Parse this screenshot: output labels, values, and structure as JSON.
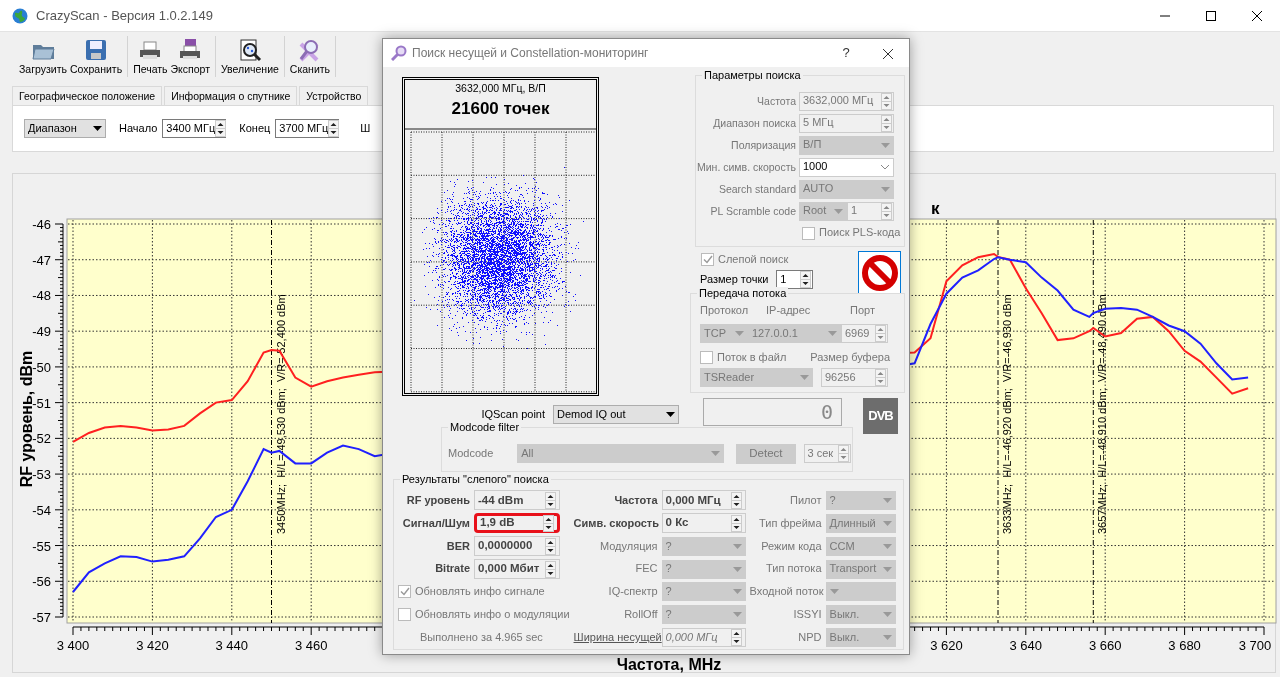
{
  "window": {
    "title": "CrazyScan - Версия 1.0.2.149"
  },
  "toolbar": {
    "groups": [
      {
        "buttons": [
          {
            "label": "Загрузить"
          },
          {
            "label": "Сохранить"
          }
        ]
      },
      {
        "buttons": [
          {
            "label": "Печать"
          },
          {
            "label": "Экспорт"
          }
        ]
      },
      {
        "buttons": [
          {
            "label": "Увеличение"
          }
        ]
      },
      {
        "buttons": [
          {
            "label": "Сканить"
          }
        ]
      }
    ]
  },
  "tabs": [
    {
      "label": "Географическое положение",
      "selected": false
    },
    {
      "label": "Информация о спутнике",
      "selected": false
    },
    {
      "label": "Устройство",
      "selected": false
    }
  ],
  "range_bar": {
    "mode": "Диапазон",
    "start_label": "Начало",
    "start": "3400 МГц",
    "end_label": "Конец",
    "end": "3700 МГц",
    "cut_label": "Ш"
  },
  "chart": {
    "chart_data": {
      "type": "line",
      "title": "к",
      "xlabel": "Частота, MHz",
      "ylabel": "RF уровень, dBm",
      "xlim": [
        3400,
        3700
      ],
      "ylim": [
        -57,
        -46
      ],
      "grid": true,
      "x": [
        3400,
        3404,
        3408,
        3412,
        3416,
        3420,
        3424,
        3428,
        3432,
        3436,
        3440,
        3444,
        3448,
        3450,
        3452,
        3456,
        3460,
        3464,
        3468,
        3472,
        3476,
        3612,
        3616,
        3620,
        3624,
        3628,
        3632,
        3633,
        3636,
        3640,
        3644,
        3648,
        3652,
        3656,
        3657,
        3660,
        3664,
        3668,
        3672,
        3676,
        3680,
        3684,
        3688,
        3692,
        3696
      ],
      "series": [
        {
          "color": "#ff2020",
          "values": [
            -52.1,
            -51.85,
            -51.7,
            -51.65,
            -51.7,
            -51.78,
            -51.75,
            -51.65,
            -51.3,
            -51.0,
            -50.93,
            -50.4,
            -49.6,
            -49.53,
            -49.55,
            -50.3,
            -50.55,
            -50.4,
            -50.3,
            -50.22,
            -50.15,
            -49.6,
            -49.2,
            -47.6,
            -47.16,
            -46.93,
            -46.84,
            -46.92,
            -47.0,
            -47.8,
            -48.5,
            -49.25,
            -49.2,
            -49.0,
            -48.91,
            -49.15,
            -49.05,
            -48.65,
            -48.6,
            -49.0,
            -49.55,
            -49.85,
            -50.3,
            -50.75,
            -50.6
          ]
        },
        {
          "color": "#2020ff",
          "values": [
            -56.3,
            -55.75,
            -55.5,
            -55.3,
            -55.32,
            -55.45,
            -55.4,
            -55.3,
            -54.8,
            -54.2,
            -54.0,
            -53.2,
            -52.3,
            -52.4,
            -52.35,
            -52.7,
            -52.7,
            -52.4,
            -52.2,
            -52.3,
            -52.5,
            -49.9,
            -48.8,
            -47.95,
            -47.5,
            -47.3,
            -46.98,
            -46.93,
            -47.0,
            -47.07,
            -47.5,
            -47.86,
            -48.4,
            -48.6,
            -48.49,
            -48.37,
            -48.35,
            -48.4,
            -48.6,
            -48.84,
            -49.0,
            -49.35,
            -49.9,
            -50.35,
            -50.3
          ]
        }
      ],
      "xticks": [
        {
          "value": 3400,
          "label": "3 400"
        },
        {
          "value": 3420,
          "label": "3 420"
        },
        {
          "value": 3440,
          "label": "3 440"
        },
        {
          "value": 3460,
          "label": "3 460"
        },
        {
          "value": 3620,
          "label": "3 620"
        },
        {
          "value": 3640,
          "label": "3 640"
        },
        {
          "value": 3660,
          "label": "3 660"
        },
        {
          "value": 3680,
          "label": "3 680"
        },
        {
          "value": 3700,
          "label": "3 700"
        }
      ],
      "yticks": [
        -46,
        -47,
        -48,
        -49,
        -50,
        -51,
        -52,
        -53,
        -54,
        -55,
        -56,
        -57
      ],
      "ref_lines": [
        {
          "axis": "x",
          "value": 3450,
          "label": "3450MHz;  H/L=-49,530 dBm;  V/R=-52,400 dBm"
        },
        {
          "axis": "x",
          "value": 3633,
          "label": "3633MHz;  H/L=-46,920 dBm;  V/R=-46,930 dBm"
        },
        {
          "axis": "x",
          "value": 3657,
          "label": "3657MHz;  H/L=-48,910 dBm;  V/R=-48,490 dBm"
        }
      ]
    }
  },
  "dialog": {
    "title": "Поиск несущей и Constellation-мониторинг",
    "help": "?",
    "constellation": {
      "frequency": "3632,000 МГц, В/П",
      "points": "21600 точек"
    },
    "search_params": {
      "legend": "Параметры поиска",
      "fields": [
        {
          "label": "Частота",
          "kind": "spin",
          "value": "3632,000 МГц",
          "disabled": true
        },
        {
          "label": "Диапазон поиска",
          "kind": "spin",
          "value": "5 МГц",
          "disabled": true
        },
        {
          "label": "Поляризация",
          "kind": "select",
          "value": "В/П",
          "disabled": true
        },
        {
          "label": "Мин. симв. скорость",
          "kind": "combo",
          "value": "1000",
          "disabled": false
        },
        {
          "label": "Search standard",
          "kind": "select",
          "value": "AUTO",
          "disabled": true
        },
        {
          "label": "PL Scramble code",
          "kind": "select-spin",
          "value": "Root",
          "value_2": "1",
          "disabled": true
        }
      ],
      "pls": {
        "label": "Поиск PLS-кода",
        "checked": false
      }
    },
    "blind_search": {
      "label": "Слепой поиск",
      "checked": true
    },
    "point_size": {
      "label": "Размер точки",
      "value": "1"
    },
    "stream": {
      "legend": "Передача потока",
      "protocol_label": "Протокол",
      "ip_label": "IP-адрес",
      "port_label": "Порт",
      "protocol": "TCP",
      "ip": "127.0.0.1",
      "port": "6969",
      "to_file": {
        "label": "Поток в файл",
        "checked": false
      },
      "buffer_label": "Размер буфера",
      "reader": "TSReader",
      "buffer": "96256"
    },
    "iqscan": {
      "label": "IQScan point",
      "value": "Demod IQ out"
    },
    "counter": "0",
    "dvb_logo": "DVB",
    "modcode": {
      "legend": "Modcode filter",
      "label": "Modcode",
      "value": "All",
      "detect": "Detect",
      "timeout": "3 сек"
    },
    "results": {
      "legend": "Результаты \"слепого\" поиска",
      "columns": [
        [
          {
            "kind": "readout",
            "label": "RF уровень",
            "value": "-44 dBm",
            "highlighted": false
          },
          {
            "kind": "readout",
            "label": "Сигнал/Шум",
            "value": "1,9 dB",
            "highlighted": true
          },
          {
            "kind": "readout",
            "label": "BER",
            "value": "0,0000000",
            "highlighted": false
          },
          {
            "kind": "readout",
            "label": "Bitrate",
            "value": "0,000 Мбит",
            "highlighted": false
          },
          {
            "kind": "checkbox",
            "label": "Обновлять инфо сигнале",
            "checked": true,
            "highlighted": false
          },
          {
            "kind": "checkbox",
            "label": "Обновлять инфо о модуляции",
            "checked": false,
            "highlighted": false
          },
          {
            "kind": "note",
            "label": "Выполнено за 4.965 sec",
            "highlighted": false
          }
        ],
        [
          {
            "kind": "readout",
            "label": "Частота",
            "value": "0,000 МГц"
          },
          {
            "kind": "readout",
            "label": "Симв. скорость",
            "value": "0 Кс"
          },
          {
            "kind": "select",
            "label": "Модуляция",
            "value": "?"
          },
          {
            "kind": "select",
            "label": "FEC",
            "value": "?"
          },
          {
            "kind": "select",
            "label": "IQ-спектр",
            "value": "?"
          },
          {
            "kind": "select",
            "label": "RollOff",
            "value": "?"
          },
          {
            "kind": "link",
            "label": "Ширина несущей",
            "value": "0,000 МГц"
          }
        ],
        [
          {
            "kind": "select",
            "label": "Пилот",
            "value": "?"
          },
          {
            "kind": "select",
            "label": "Тип фрейма",
            "value": "Длинный"
          },
          {
            "kind": "select",
            "label": "Режим кода",
            "value": "CCM"
          },
          {
            "kind": "select",
            "label": "Тип потока",
            "value": "Transport"
          },
          {
            "kind": "select",
            "label": "Входной поток"
          },
          {
            "kind": "select",
            "label": "ISSYI",
            "value": "Выкл."
          },
          {
            "kind": "select",
            "label": "NPD",
            "value": "Выкл."
          }
        ]
      ]
    }
  }
}
